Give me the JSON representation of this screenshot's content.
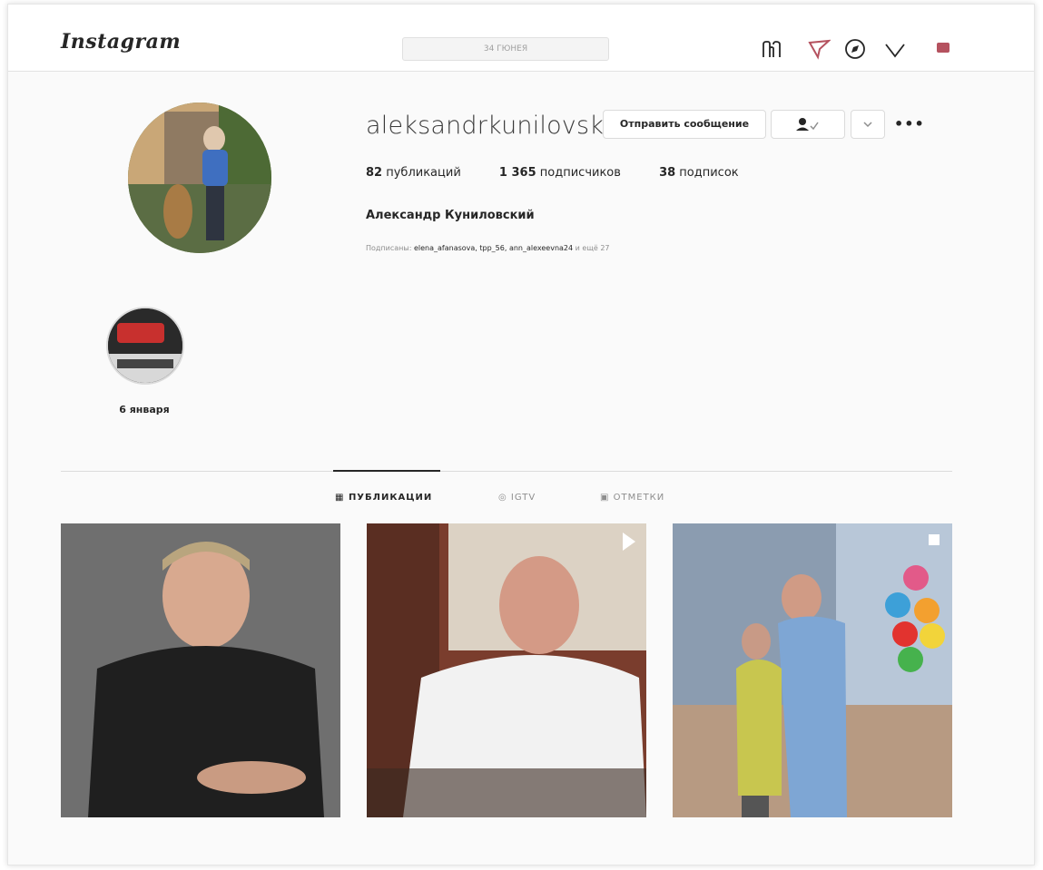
{
  "header": {
    "logo": "Instagram",
    "search_text": "34 ГЮНЕЯ",
    "icons": [
      "home-icon",
      "direct-icon",
      "explore-icon",
      "heart-icon",
      "avatar-icon"
    ]
  },
  "profile": {
    "username": "aleksandrkunilovskii",
    "message_button": "Отправить сообщение",
    "stats": {
      "posts_count": "82",
      "posts_label": "публикаций",
      "followers_count": "1 365",
      "followers_label": "подписчиков",
      "following_count": "38",
      "following_label": "подписок"
    },
    "full_name": "Александр Куниловский",
    "followed_by_prefix": "Подписаны:",
    "followed_by_names": "elena_afanasova, tpp_56, ann_alexeevna24",
    "followed_by_more": "и ещё 27"
  },
  "highlights": [
    {
      "label": "6 января"
    }
  ],
  "tabs": [
    {
      "label": "ПУБЛИКАЦИИ",
      "active": true
    },
    {
      "label": "IGTV",
      "active": false
    },
    {
      "label": "ОТМЕТКИ",
      "active": false
    }
  ],
  "posts": [
    {
      "kind": "photo"
    },
    {
      "kind": "video"
    },
    {
      "kind": "carousel"
    }
  ],
  "colors": {
    "accent": "#262626",
    "muted": "#8e8e8e",
    "border": "#dbdbdb",
    "profile_dot": "#b5525f"
  }
}
